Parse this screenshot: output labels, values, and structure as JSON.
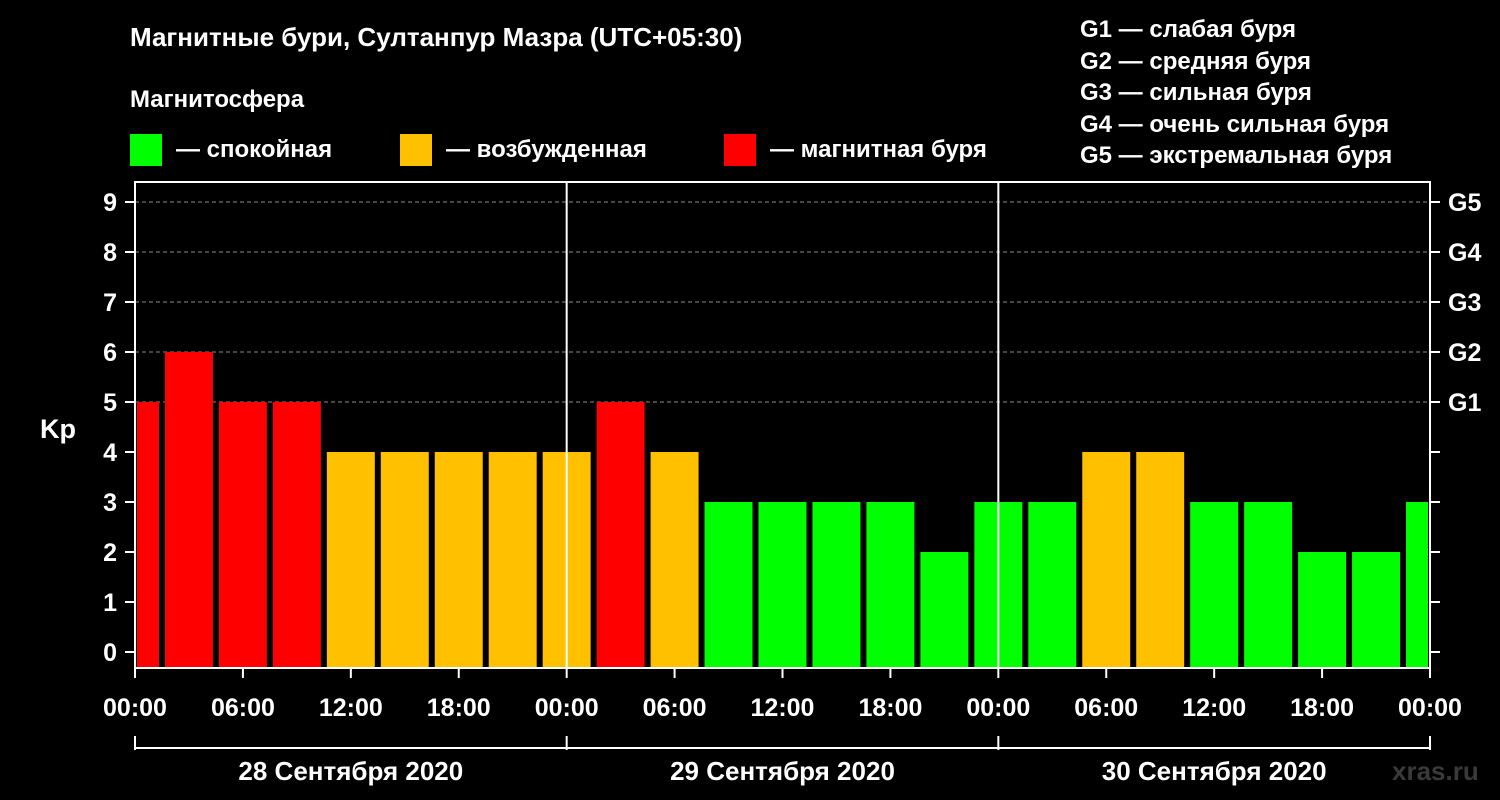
{
  "title": "Магнитные бури, Султанпур Мазра (UTC+05:30)",
  "subtitle": "Магнитосфера",
  "legend": [
    {
      "label": "— спокойная",
      "color": "#00ff00"
    },
    {
      "label": "— возбужденная",
      "color": "#ffc000"
    },
    {
      "label": "— магнитная буря",
      "color": "#ff0000"
    }
  ],
  "g_levels": [
    "G1 — слабая буря",
    "G2 — средняя буря",
    "G3 — сильная буря",
    "G4 — очень сильная буря",
    "G5 — экстремальная буря"
  ],
  "watermark": "xras.ru",
  "chart_data": {
    "type": "bar",
    "ylabel": "Kp",
    "ylim": [
      0,
      9
    ],
    "yticks": [
      "0",
      "1",
      "2",
      "3",
      "4",
      "5",
      "6",
      "7",
      "8",
      "9"
    ],
    "right_ticks": [
      {
        "kp": 5,
        "label": "G1"
      },
      {
        "kp": 6,
        "label": "G2"
      },
      {
        "kp": 7,
        "label": "G3"
      },
      {
        "kp": 8,
        "label": "G4"
      },
      {
        "kp": 9,
        "label": "G5"
      }
    ],
    "grid": "dashed horizontal at Kp 5-9",
    "xticks": [
      "00:00",
      "06:00",
      "12:00",
      "18:00",
      "00:00",
      "06:00",
      "12:00",
      "18:00",
      "00:00",
      "06:00",
      "12:00",
      "18:00",
      "00:00"
    ],
    "days": [
      "28 Сентября 2020",
      "29 Сентября 2020",
      "30 Сентября 2020"
    ],
    "bars": [
      {
        "start_h": 0,
        "end_h": 1.5,
        "kp": 5,
        "color": "#ff0000"
      },
      {
        "start_h": 1.5,
        "end_h": 4.5,
        "kp": 6,
        "color": "#ff0000"
      },
      {
        "start_h": 4.5,
        "end_h": 7.5,
        "kp": 5,
        "color": "#ff0000"
      },
      {
        "start_h": 7.5,
        "end_h": 10.5,
        "kp": 5,
        "color": "#ff0000"
      },
      {
        "start_h": 10.5,
        "end_h": 13.5,
        "kp": 4,
        "color": "#ffc000"
      },
      {
        "start_h": 13.5,
        "end_h": 16.5,
        "kp": 4,
        "color": "#ffc000"
      },
      {
        "start_h": 16.5,
        "end_h": 19.5,
        "kp": 4,
        "color": "#ffc000"
      },
      {
        "start_h": 19.5,
        "end_h": 22.5,
        "kp": 4,
        "color": "#ffc000"
      },
      {
        "start_h": 22.5,
        "end_h": 25.5,
        "kp": 4,
        "color": "#ffc000"
      },
      {
        "start_h": 25.5,
        "end_h": 28.5,
        "kp": 5,
        "color": "#ff0000"
      },
      {
        "start_h": 28.5,
        "end_h": 31.5,
        "kp": 4,
        "color": "#ffc000"
      },
      {
        "start_h": 31.5,
        "end_h": 34.5,
        "kp": 3,
        "color": "#00ff00"
      },
      {
        "start_h": 34.5,
        "end_h": 37.5,
        "kp": 3,
        "color": "#00ff00"
      },
      {
        "start_h": 37.5,
        "end_h": 40.5,
        "kp": 3,
        "color": "#00ff00"
      },
      {
        "start_h": 40.5,
        "end_h": 43.5,
        "kp": 3,
        "color": "#00ff00"
      },
      {
        "start_h": 43.5,
        "end_h": 46.5,
        "kp": 2,
        "color": "#00ff00"
      },
      {
        "start_h": 46.5,
        "end_h": 49.5,
        "kp": 3,
        "color": "#00ff00"
      },
      {
        "start_h": 49.5,
        "end_h": 52.5,
        "kp": 3,
        "color": "#00ff00"
      },
      {
        "start_h": 52.5,
        "end_h": 55.5,
        "kp": 4,
        "color": "#ffc000"
      },
      {
        "start_h": 55.5,
        "end_h": 58.5,
        "kp": 4,
        "color": "#ffc000"
      },
      {
        "start_h": 58.5,
        "end_h": 61.5,
        "kp": 3,
        "color": "#00ff00"
      },
      {
        "start_h": 61.5,
        "end_h": 64.5,
        "kp": 3,
        "color": "#00ff00"
      },
      {
        "start_h": 64.5,
        "end_h": 67.5,
        "kp": 2,
        "color": "#00ff00"
      },
      {
        "start_h": 67.5,
        "end_h": 70.5,
        "kp": 2,
        "color": "#00ff00"
      },
      {
        "start_h": 70.5,
        "end_h": 72,
        "kp": 3,
        "color": "#00ff00"
      }
    ]
  }
}
